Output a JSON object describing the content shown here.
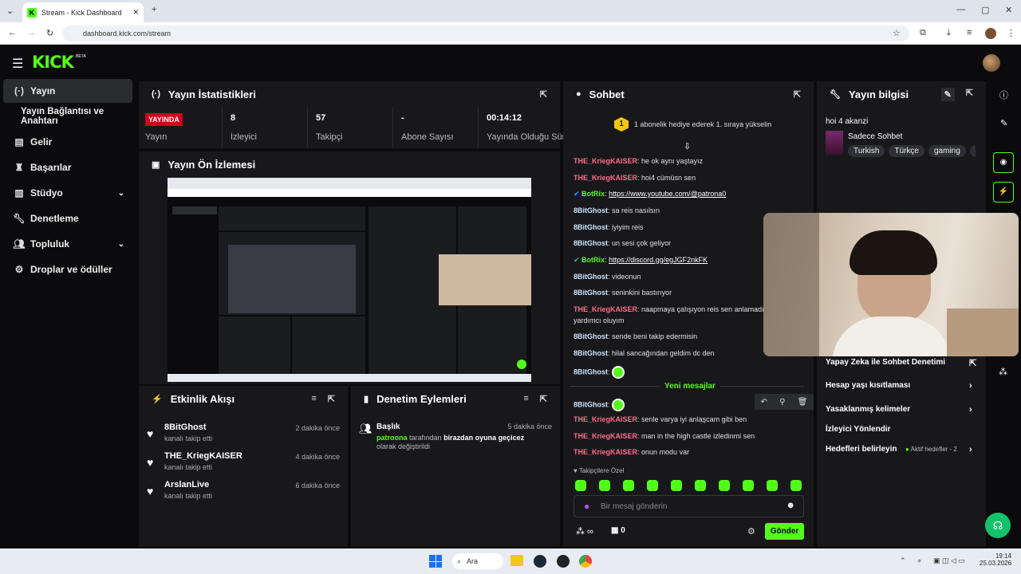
{
  "browser": {
    "tab_title": "Stream - Kick Dashboard",
    "url": "dashboard.kick.com/stream"
  },
  "header": {
    "logo": "KICK",
    "beta": "BETA"
  },
  "sidebar": {
    "items": [
      {
        "label": "Yayın",
        "icon": "broadcast-icon"
      },
      {
        "label": "Yayın Bağlantısı ve Anahtarı",
        "icon": ""
      },
      {
        "label": "Gelir",
        "icon": "chart-icon"
      },
      {
        "label": "Başarılar",
        "icon": "trophy-icon"
      },
      {
        "label": "Stüdyo",
        "icon": "studio-icon"
      },
      {
        "label": "Denetleme",
        "icon": "wrench-icon"
      },
      {
        "label": "Topluluk",
        "icon": "people-icon"
      },
      {
        "label": "Droplar ve ödüller",
        "icon": "gift-icon"
      }
    ]
  },
  "stats": {
    "title": "Yayın İstatistikleri",
    "live_badge": "YAYINDA",
    "live_label": "Yayın",
    "cells": [
      {
        "value": "8",
        "label": "İzleyici"
      },
      {
        "value": "57",
        "label": "Takipçi"
      },
      {
        "value": "-",
        "label": "Abone Sayısı"
      },
      {
        "value": "00:14:12",
        "label": "Yayında Olduğu Süre"
      }
    ]
  },
  "preview": {
    "title": "Yayın Ön İzlemesi"
  },
  "activity": {
    "title": "Etkinlik Akışı",
    "items": [
      {
        "name": "8BitGhost",
        "sub": "kanalı takip etti",
        "time": "2 dakika önce"
      },
      {
        "name": "THE_KriegKAISER",
        "sub": "kanalı takip etti",
        "time": "4 dakika önce"
      },
      {
        "name": "ArslanLive",
        "sub": "kanalı takip etti",
        "time": "6 dakika önce"
      }
    ]
  },
  "moderation": {
    "title": "Denetim Eylemleri",
    "item": {
      "title": "Başlık",
      "time": "5 dakika önce",
      "user": "patroona",
      "mid": " tarafından ",
      "value": "birazdan oyuna geçicez",
      "end": " olarak değiştirildi"
    }
  },
  "chat": {
    "title": "Sohbet",
    "pinned": "1 abonelik hediye ederek 1. sıraya yükselin",
    "pinned_rank": "1",
    "new_messages": "Yeni mesajlar",
    "followers_only": "Takipçilere Özel",
    "input_placeholder": "Bir mesaj gönderin",
    "send": "Gönder",
    "count": "0",
    "messages": [
      {
        "user": "THE_KriegKAISER",
        "text": "he ok aynı yaştayız",
        "cls": "kriege"
      },
      {
        "user": "THE_KriegKAISER",
        "text": "hoi4 cümüsn sen",
        "cls": "kriege"
      },
      {
        "user": "BotRix",
        "text": "https://www.youtube.com/@patrona0",
        "cls": "bot"
      },
      {
        "user": "8BitGhost",
        "text": "sa reis nasılsın",
        "cls": "ghost"
      },
      {
        "user": "8BitGhost",
        "text": "iyiyim reis",
        "cls": "ghost"
      },
      {
        "user": "8BitGhost",
        "text": "un sesi çok geliyor",
        "cls": "ghost"
      },
      {
        "user": "BotRix",
        "text": "https://discord.gg/egJGF2nkFK",
        "cls": "bot"
      },
      {
        "user": "8BitGhost",
        "text": "videonun",
        "cls": "ghost"
      },
      {
        "user": "8BitGhost",
        "text": "seninkini bastırıyor",
        "cls": "ghost"
      },
      {
        "user": "THE_KriegKAISER",
        "text": "naapmaya çalışıyon reis sen anlamadım",
        "cls": "kriege"
      },
      {
        "user": "",
        "text": "yardımcı oluyım",
        "cls": "cont"
      },
      {
        "user": "8BitGhost",
        "text": "sende beni takip edermisin",
        "cls": "ghost"
      },
      {
        "user": "8BitGhost",
        "text": "hilal sancağından geldim dc den",
        "cls": "ghost"
      },
      {
        "user": "8BitGhost",
        "text": "",
        "cls": "ghost"
      },
      {
        "user": "8BitGhost",
        "text": "",
        "cls": "ghost"
      },
      {
        "user": "THE_KriegKAISER",
        "text": "senle varya iyi anlaşcam gibi ben",
        "cls": "kriege"
      },
      {
        "user": "THE_KriegKAISER",
        "text": "man in the high castle izledinmi sen",
        "cls": "kriege"
      },
      {
        "user": "THE_KriegKAISER",
        "text": "onun modu var",
        "cls": "kriege"
      }
    ]
  },
  "info": {
    "title": "Yayın bilgisi",
    "stream_title": "hoi 4 akanzi",
    "category": "Sadece Sohbet",
    "tags": [
      "Turkish",
      "Türkçe",
      "gaming",
      "he"
    ],
    "rows": [
      {
        "label": "Yapay Zeka ile Sohbet Denetimi"
      },
      {
        "label": "Hesap yaşı kısıtlaması"
      },
      {
        "label": "Yasaklanmış kelimeler"
      },
      {
        "label": "İzleyici Yönlendir"
      },
      {
        "label": "Hedefleri belirleyin",
        "extra": "Aktif hedefler - 2"
      }
    ]
  },
  "taskbar": {
    "search": "Ara",
    "time": "19:14",
    "date": "25.03.2026"
  },
  "colors": {
    "brand": "#53fc18",
    "live": "#d0021b",
    "panel": "#18181b"
  }
}
